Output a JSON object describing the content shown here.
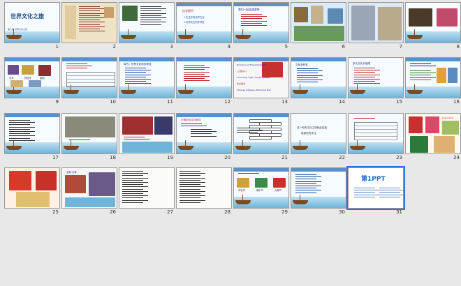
{
  "slides": [
    {
      "n": "1",
      "title": "世界文化之旅",
      "sub": "第六课 世界文化之旅"
    },
    {
      "n": "2"
    },
    {
      "n": "3"
    },
    {
      "n": "4",
      "heading": "自学提问",
      "lines": [
        "1.生活中的世界文化",
        "2.世界文化的多样性"
      ]
    },
    {
      "n": "5",
      "heading": "我们一起去旅游吧",
      "lines": []
    },
    {
      "n": "6"
    },
    {
      "n": "7"
    },
    {
      "n": "8"
    },
    {
      "n": "9",
      "labels": [
        "日本",
        "西班牙",
        "英国"
      ]
    },
    {
      "n": "10"
    },
    {
      "n": "11",
      "heading": "探究：世界文化的多样性"
    },
    {
      "n": "12"
    },
    {
      "n": "13",
      "lines": [
        "Romance of Three Kingdoms",
        "(三国演义)",
        "Crouching Tiger, Hidden Dragon",
        "卧虎藏龙",
        "Chinese Odyssey, Pandora's Box"
      ]
    },
    {
      "n": "14",
      "heading": "文化多样性"
    },
    {
      "n": "15",
      "heading": "多元文化价值观"
    },
    {
      "n": "16"
    },
    {
      "n": "17"
    },
    {
      "n": "18"
    },
    {
      "n": "19"
    },
    {
      "n": "20",
      "heading": "正确对待文化差异"
    },
    {
      "n": "21"
    },
    {
      "n": "22",
      "lines": [
        "这一份的文化之旅就此结束",
        "感谢您的关注"
      ]
    },
    {
      "n": "23"
    },
    {
      "n": "24",
      "caption": "Jingle Bells"
    },
    {
      "n": "25"
    },
    {
      "n": "26",
      "heading": "圣诞·元宵"
    },
    {
      "n": "27"
    },
    {
      "n": "28"
    },
    {
      "n": "29",
      "labels": [
        "中秋节",
        "端午节",
        "元宵节"
      ]
    },
    {
      "n": "30"
    },
    {
      "n": "31",
      "logo": "第1PPT"
    }
  ],
  "colors": {
    "accent": "#1b4a8a",
    "banner": "#5a8fc8",
    "selected": "#3a6fd8"
  }
}
